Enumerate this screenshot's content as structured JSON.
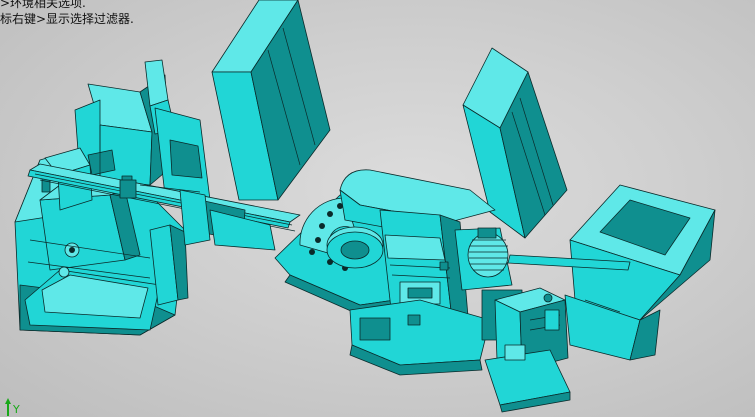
{
  "hint": {
    "line1": ">环境相关选项.",
    "line2": "标右键>显示选择过滤器."
  },
  "triad": {
    "y_label": "Y"
  },
  "colors": {
    "background": "#cfcfcf",
    "model_fill": "#21d6d6",
    "model_light": "#5fe8e8",
    "model_dark": "#0f8f8f",
    "edge": "#0a2a2a",
    "triad": "#1aa81a"
  },
  "scene": {
    "objects": [
      "left-machine-assembly",
      "left-conveyor-rail",
      "left-cabinet",
      "center-rotary-table",
      "center-machine-base",
      "motor-unit",
      "right-cabinet",
      "hopper",
      "hydraulic-unit"
    ]
  }
}
